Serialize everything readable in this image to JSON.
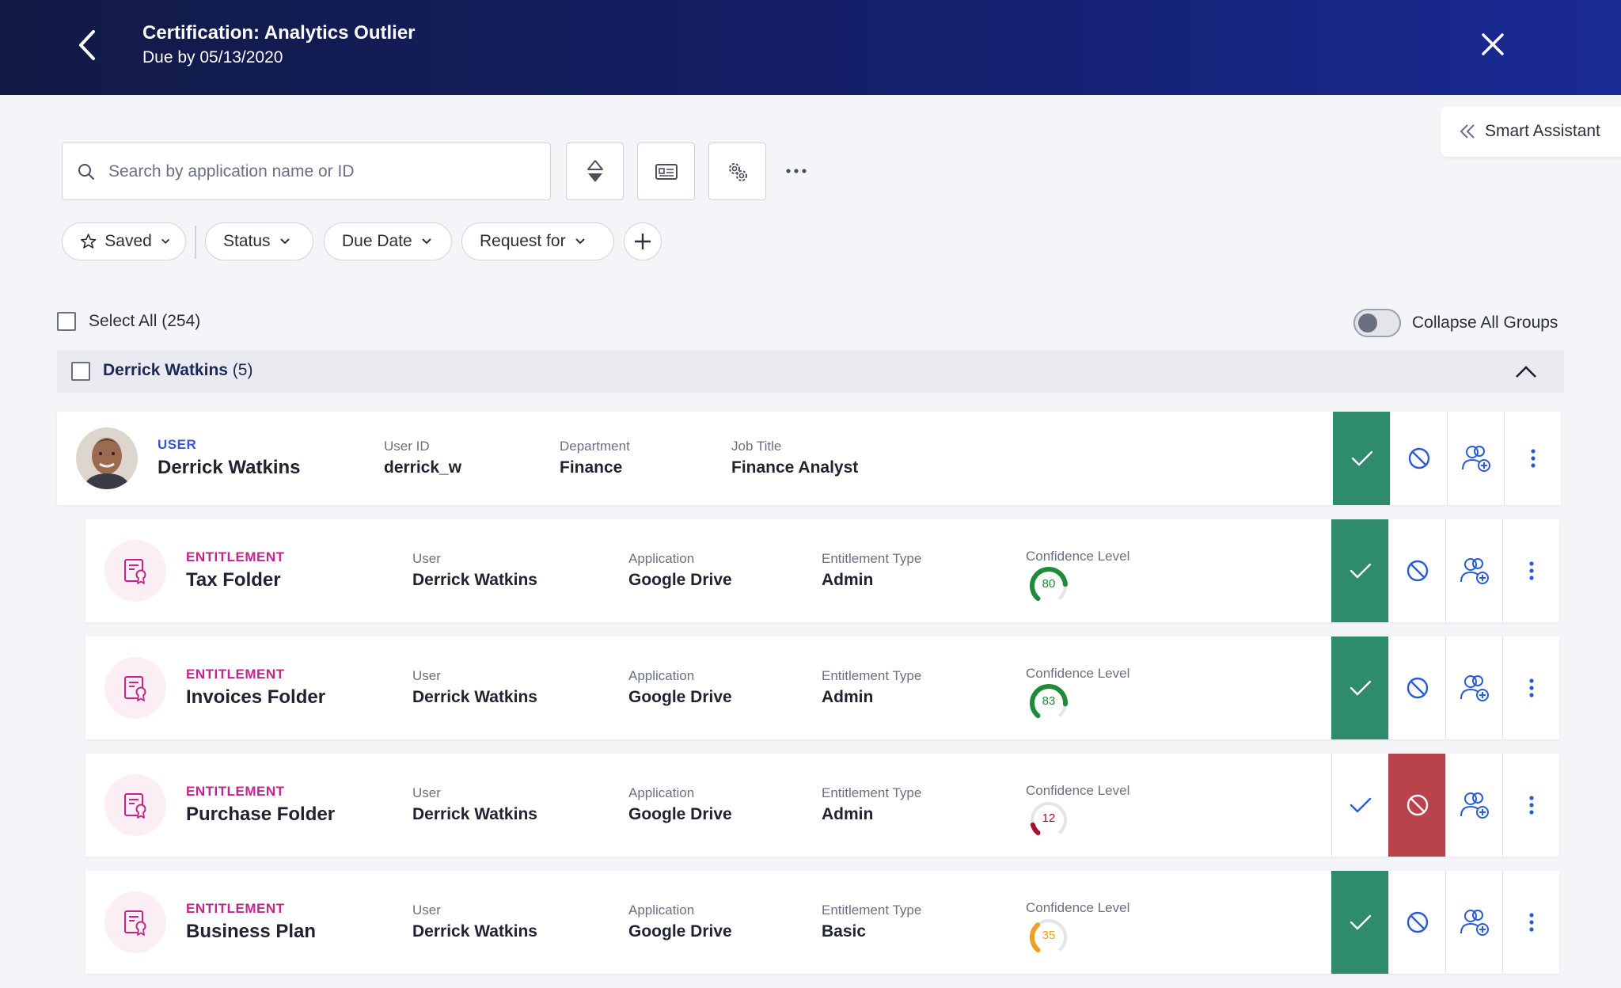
{
  "header": {
    "title": "Certification: Analytics Outlier",
    "subtitle": "Due by 05/13/2020"
  },
  "smart_assistant": {
    "label": "Smart Assistant"
  },
  "search": {
    "placeholder": "Search by application name or ID"
  },
  "filters": [
    {
      "label": "Saved"
    },
    {
      "label": "Status"
    },
    {
      "label": "Due Date"
    },
    {
      "label": "Request for"
    }
  ],
  "select_all": {
    "label": "Select All (254)"
  },
  "collapse": {
    "label": "Collapse All Groups",
    "on": false
  },
  "group": {
    "name": "Derrick Watkins",
    "count": "(5)"
  },
  "user": {
    "kind": "USER",
    "name": "Derrick Watkins",
    "fields": [
      {
        "label": "User ID",
        "value": "derrick_w"
      },
      {
        "label": "Department",
        "value": "Finance"
      },
      {
        "label": "Job Title",
        "value": "Finance Analyst"
      }
    ],
    "decision": "approved"
  },
  "entitlements": [
    {
      "kind": "ENTITLEMENT",
      "name": "Tax Folder",
      "user_label": "User",
      "user": "Derrick Watkins",
      "app_label": "Application",
      "app": "Google Drive",
      "type_label": "Entitlement Type",
      "type": "Admin",
      "confidence_label": "Confidence Level",
      "confidence": "80",
      "gauge_color": "#1e8a3a",
      "decision": "approved"
    },
    {
      "kind": "ENTITLEMENT",
      "name": "Invoices Folder",
      "user_label": "User",
      "user": "Derrick Watkins",
      "app_label": "Application",
      "app": "Google Drive",
      "type_label": "Entitlement Type",
      "type": "Admin",
      "confidence_label": "Confidence Level",
      "confidence": "83",
      "gauge_color": "#1e8a3a",
      "decision": "approved"
    },
    {
      "kind": "ENTITLEMENT",
      "name": "Purchase Folder",
      "user_label": "User",
      "user": "Derrick Watkins",
      "app_label": "Application",
      "app": "Google Drive",
      "type_label": "Entitlement Type",
      "type": "Admin",
      "confidence_label": "Confidence Level",
      "confidence": "12",
      "gauge_color": "#a3122a",
      "decision": "revoked"
    },
    {
      "kind": "ENTITLEMENT",
      "name": "Business Plan",
      "user_label": "User",
      "user": "Derrick Watkins",
      "app_label": "Application",
      "app": "Google Drive",
      "type_label": "Entitlement Type",
      "type": "Basic",
      "confidence_label": "Confidence Level",
      "confidence": "35",
      "gauge_color": "#f0a020",
      "decision": "approved"
    }
  ],
  "colors": {
    "header_start": "#121a45",
    "header_end": "#1a2a95",
    "approve": "#2e8b6e",
    "revoke": "#b8434a",
    "user_label": "#3a56d6",
    "entitlement_label": "#c2268a",
    "icon_blue": "#2a5bd7"
  },
  "icons": [
    "chevron-left-icon",
    "close-icon",
    "double-chevron-left-icon",
    "search-icon",
    "sort-icon",
    "id-card-icon",
    "gears-icon",
    "ellipsis-icon",
    "star-icon",
    "chevron-down-icon",
    "plus-icon",
    "chevron-up-icon",
    "check-icon",
    "block-icon",
    "user-add-icon",
    "kebab-icon",
    "certificate-icon"
  ]
}
